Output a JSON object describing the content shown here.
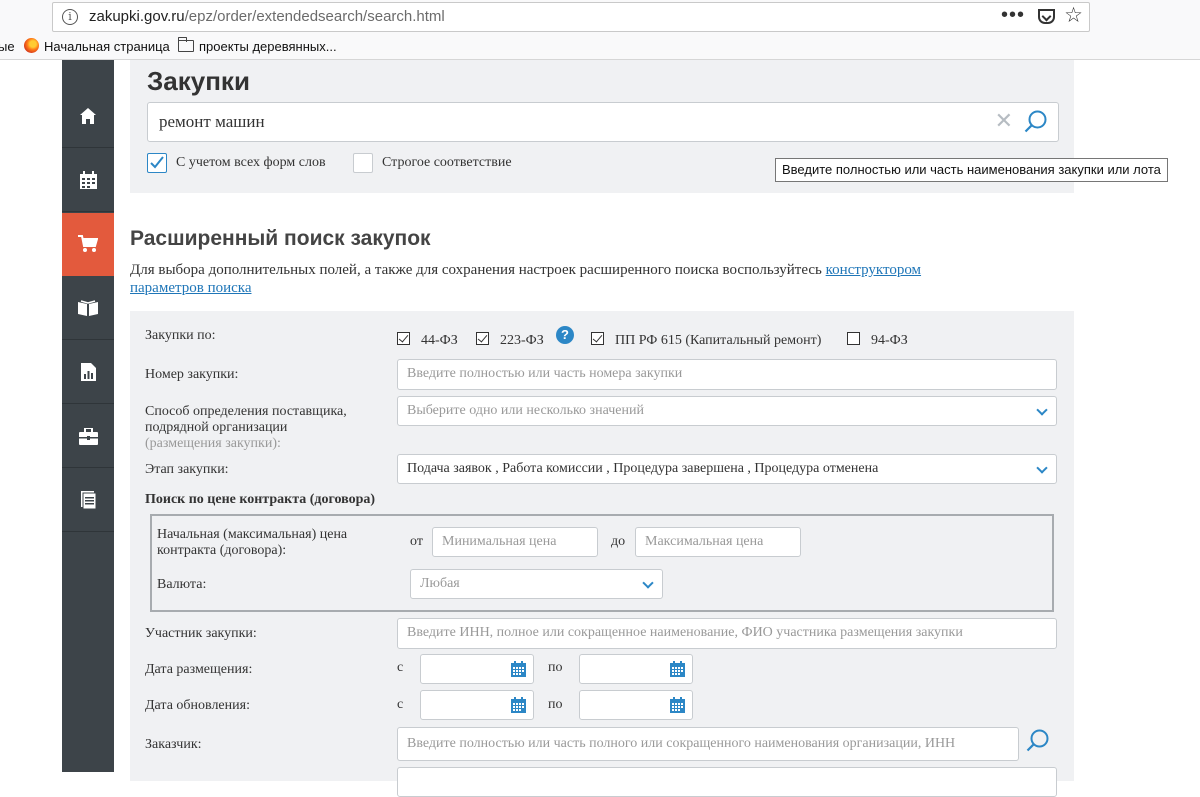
{
  "browser": {
    "url_host": "zakupki.gov.ru",
    "url_path": "/epz/order/extendedsearch/search.html",
    "bookmarks": [
      "Начальная страница",
      "проекты деревянных..."
    ],
    "bookmark_cut": "ые"
  },
  "sidebar": {
    "items": [
      {
        "icon": "home-icon"
      },
      {
        "icon": "calendar-icon"
      },
      {
        "icon": "cart-icon",
        "active": true
      },
      {
        "icon": "book-icon"
      },
      {
        "icon": "report-icon"
      },
      {
        "icon": "briefcase-icon"
      },
      {
        "icon": "document-icon"
      }
    ]
  },
  "search": {
    "title": "Закупки",
    "query": "ремонт машин",
    "opt_all_forms": "С учетом всех форм слов",
    "opt_strict": "Строгое соответствие",
    "tooltip": "Введите полностью или часть наименования закупки или лота"
  },
  "advanced": {
    "title": "Расширенный поиск закупок",
    "desc_prefix": "Для выбора дополнительных полей, а также для сохранения настроек расширенного поиска воспользуйтесь ",
    "desc_link1": "конструктором",
    "desc_link2": "параметров поиска"
  },
  "form": {
    "purchases_by_label": "Закупки по:",
    "laws": [
      {
        "label": "44-ФЗ",
        "checked": true
      },
      {
        "label": "223-ФЗ",
        "checked": true
      },
      {
        "label": "ПП РФ 615 (Капитальный ремонт)",
        "checked": true
      },
      {
        "label": "94-ФЗ",
        "checked": false
      }
    ],
    "number_label": "Номер закупки:",
    "number_placeholder": "Введите полностью или часть номера закупки",
    "method_label_1": "Способ определения поставщика,",
    "method_label_2": "подрядной организации",
    "method_label_3": "(размещения закупки):",
    "method_placeholder": "Выберите одно или несколько значений",
    "stage_label": "Этап закупки:",
    "stage_value": "Подача заявок , Работа комиссии , Процедура завершена , Процедура отменена",
    "price_section": "Поиск по цене контракта (договора)",
    "price_label_1": "Начальная (максимальная) цена",
    "price_label_2": "контракта (договора):",
    "from": "от",
    "to": "до",
    "min_price": "Минимальная цена",
    "max_price": "Максимальная цена",
    "currency_label": "Валюта:",
    "currency_value": "Любая",
    "participant_label": "Участник закупки:",
    "participant_placeholder": "Введите ИНН, полное или сокращенное наименование, ФИО участника размещения закупки",
    "posted_label": "Дата размещения:",
    "updated_label": "Дата обновления:",
    "date_from": "с",
    "date_to": "по",
    "customer_label": "Заказчик:",
    "customer_placeholder": "Введите полностью или часть полного или сокращенного наименования организации, ИНН"
  }
}
